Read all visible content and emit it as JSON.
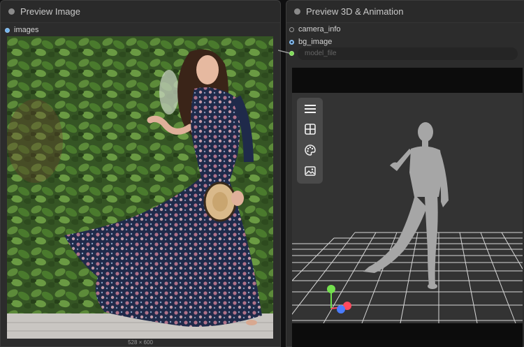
{
  "left_node": {
    "title": "Preview Image",
    "input_label": "images",
    "image_size": "528 × 600"
  },
  "right_node": {
    "title": "Preview 3D & Animation",
    "inputs": [
      "camera_info",
      "bg_image"
    ],
    "model_file_placeholder": "model_file",
    "toolbar_icons": [
      "menu-icon",
      "layout-grid-icon",
      "palette-icon",
      "image-icon"
    ]
  },
  "colors": {
    "node_bg": "#2c2c2c",
    "socket_image": "#6fb3ee",
    "socket_model": "#7ed957",
    "viewport_bg": "#333333"
  }
}
